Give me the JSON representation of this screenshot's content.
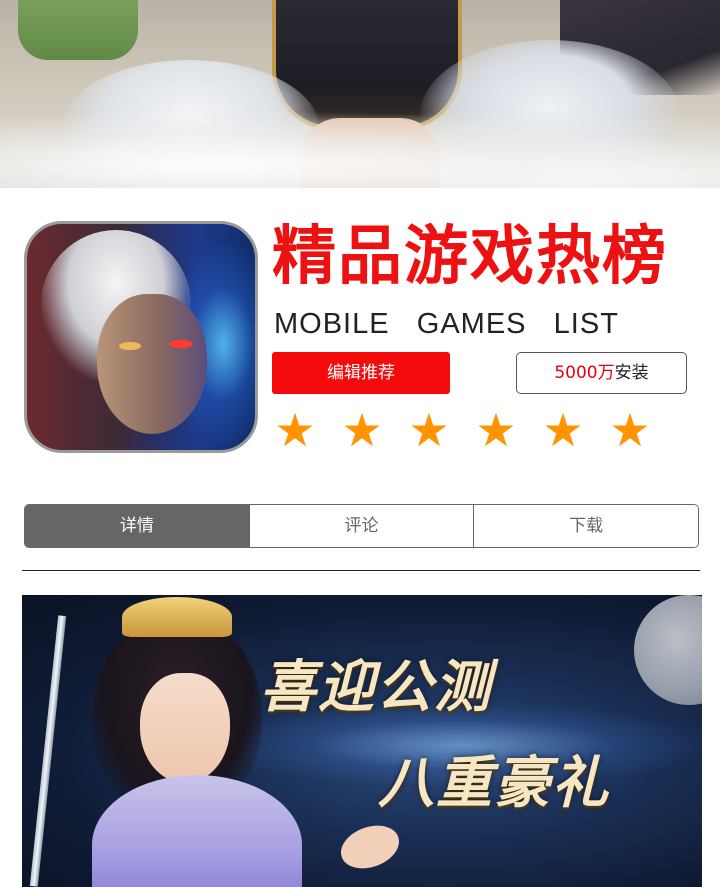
{
  "header": {
    "title_cn": "精品游戏热榜",
    "title_en": "MOBILE   GAMES   LIST"
  },
  "actions": {
    "editor_recommend_label": "编辑推荐",
    "installs_count": "5000万",
    "installs_suffix": "安装"
  },
  "rating": {
    "stars": 6,
    "star_glyph": "★",
    "star_color": "#ff9400"
  },
  "tabs": [
    {
      "label": "详情",
      "active": true
    },
    {
      "label": "评论",
      "active": false
    },
    {
      "label": "下载",
      "active": false
    }
  ],
  "promo": {
    "line1": "喜迎公测",
    "line2": "八重豪礼"
  },
  "colors": {
    "accent_red": "#f40c0c",
    "title_red": "#ee1111",
    "tab_active_bg": "#666666"
  },
  "icons": {
    "hero_banner": "game-hero-banner-image",
    "game_icon": "game-app-icon-image",
    "promo_banner": "promo-banner-image"
  }
}
